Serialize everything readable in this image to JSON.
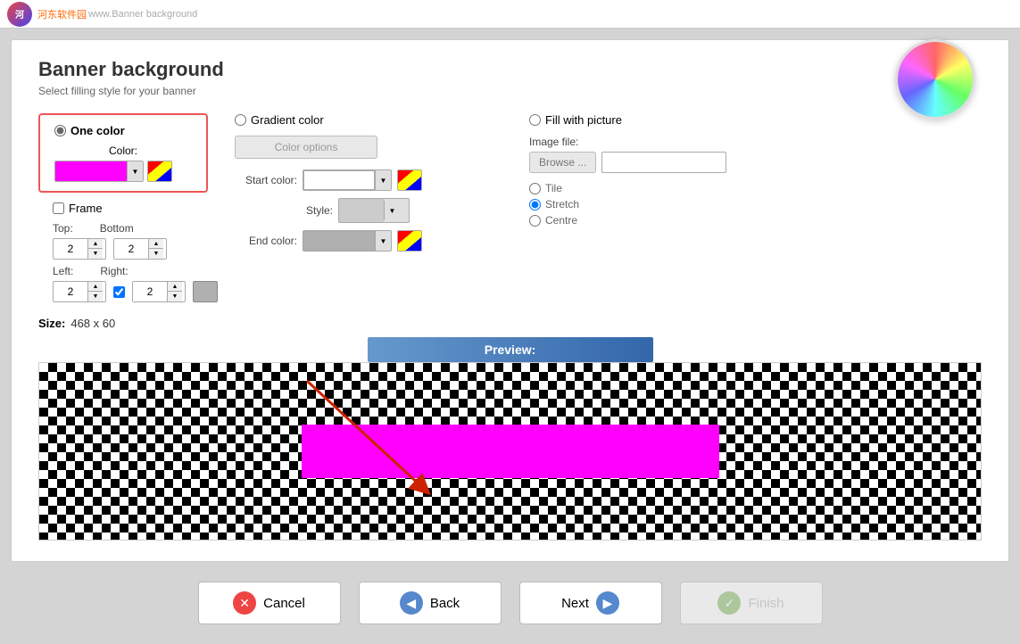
{
  "watermark": {
    "site": "河东软件园",
    "url": "www.Banner background"
  },
  "page": {
    "title": "Banner background",
    "subtitle": "Select filling style for your banner"
  },
  "one_color": {
    "label": "One color",
    "color_label": "Color:",
    "selected": true
  },
  "gradient_color": {
    "label": "Gradient color",
    "btn_label": "Color options",
    "start_label": "Start color:",
    "end_label": "End color:",
    "style_label": "Style:"
  },
  "fill_picture": {
    "label": "Fill with picture",
    "image_file_label": "Image file:",
    "browse_label": "Browse ...",
    "tile_label": "Tile",
    "stretch_label": "Stretch",
    "centre_label": "Centre"
  },
  "frame": {
    "label": "Frame",
    "top_label": "Top:",
    "bottom_label": "Bottom",
    "left_label": "Left:",
    "right_label": "Right:",
    "top_val": "2",
    "bottom_val": "2",
    "left_val": "2",
    "right_val": "2"
  },
  "size": {
    "label": "Size:",
    "value": "468 x 60"
  },
  "preview": {
    "label": "Preview:"
  },
  "buttons": {
    "cancel": "Cancel",
    "back": "Back",
    "next": "Next",
    "finish": "Finish"
  }
}
